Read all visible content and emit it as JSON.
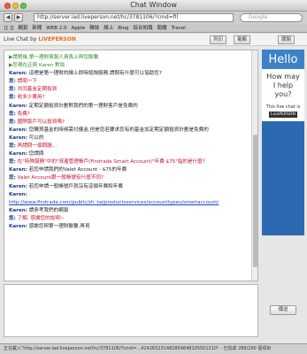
{
  "window": {
    "title": "Chat Window"
  },
  "toolbar": {
    "back": "◀",
    "forward": "▶",
    "url": "http://server.iad.liveperson.net/hc/3781106/?cmd=fil",
    "search_placeholder": "Google"
  },
  "bookmarks": [
    "[[ ]]",
    "網頁",
    "新聞",
    "WEB 2.0",
    "Apple",
    "雜誌",
    "線上",
    "Blog",
    "綜合知識",
    "閱讀",
    "Travel"
  ],
  "header": {
    "brand_prefix": "Live Chat by",
    "brand_name": "LIVEPERSON",
    "print": "列印",
    "email": "電郵",
    "close": "關閉"
  },
  "messages": [
    {
      "type": "sys",
      "text": "▶請稍後,第一理財客服人員馬上與您聯繫."
    },
    {
      "type": "sys",
      "text": "▶您現在正與 Karen 對談."
    },
    {
      "type": "agent",
      "who": "Karen:",
      "text": " 這裡是第一理財的線上即時諮詢服務,請問有什麼可以協助您?"
    },
    {
      "type": "visitor",
      "who": "您:",
      "text": " 請問一下"
    },
    {
      "type": "visitor",
      "who": "您:",
      "text": " 共同基金定期投資"
    },
    {
      "type": "visitor",
      "who": "您:",
      "text": " 收多少費用?"
    },
    {
      "type": "agent",
      "who": "Karen:",
      "text": " 定期定額投資計劃對我們的第一理財客戶是免費的"
    },
    {
      "type": "visitor",
      "who": "您:",
      "text": " 免費?"
    },
    {
      "type": "visitor",
      "who": "您:",
      "text": " 國際版戶可以投資嗎?"
    },
    {
      "type": "agent",
      "who": "Karen:",
      "text": " 您購買基金的時候需付傭金,但是您若要求您有的基金加定期定額投資計劃是免費的"
    },
    {
      "type": "agent",
      "who": "Karen:",
      "text": " 可以的"
    },
    {
      "type": "visitor",
      "who": "您:",
      "text": " 再請問一個問題..."
    },
    {
      "type": "agent",
      "who": "Karen:",
      "text": " 您請問"
    },
    {
      "type": "visitor",
      "who": "您:",
      "text": " 在\"特殊服務\"中的\"資產管理帳戶(Firstrade Smart Account)\"年費 $75\"指的是什麼?"
    },
    {
      "type": "agent",
      "who": "Karen:",
      "text": " 若您申請我們的Valet Account - $75的年費"
    },
    {
      "type": "visitor",
      "who": "您:",
      "text": " Valet Account跟一般帳號有什麼不同?"
    },
    {
      "type": "agent",
      "who": "Karen:",
      "text": " 若您申請一般帳號戶就沒有這個年費和年費"
    },
    {
      "type": "agent",
      "who": "Karen:",
      "text": ""
    },
    {
      "type": "link",
      "text": "http://www.firstrade.com/public/zh_tw/productsservices/accounttypes/smartaccount/"
    },
    {
      "type": "agent",
      "who": "Karen:",
      "text": " 請參考我們的網頁"
    },
    {
      "type": "visitor",
      "who": "您:",
      "text": " 了解, 感謝您的說明~"
    },
    {
      "type": "agent",
      "who": "Karen:",
      "text": " 感謝您與第一理財聯繫,再見"
    }
  ],
  "ad": {
    "hello": "Hello",
    "help_line1": "How may",
    "help_line2": "I help",
    "help_line3": "you?",
    "live": "This live chat is",
    "powered": "LivePERSON"
  },
  "send": "傳送",
  "status": "正在載入\"http://server.iad.liveperson.net/hc/3781106/?cmd=...424265231482854848105501210\" - 已完成 289/290 個項目"
}
